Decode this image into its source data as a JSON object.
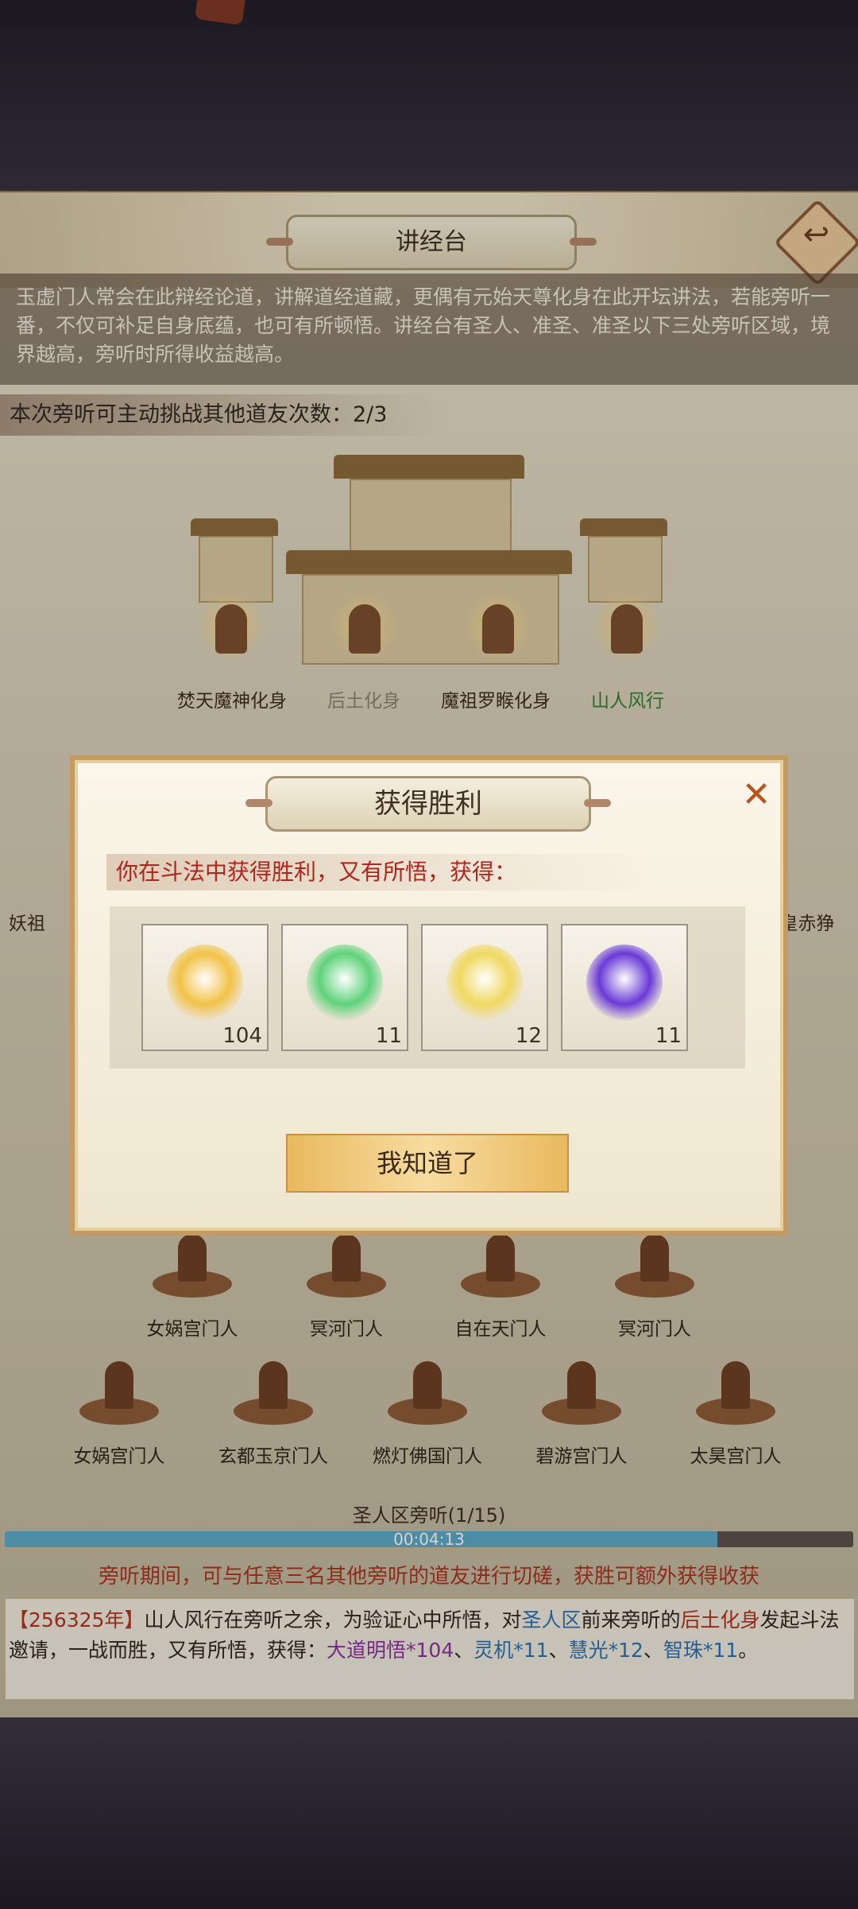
{
  "page": {
    "title": "讲经台",
    "intro": "玉虚门人常会在此辩经论道，讲解道经道藏，更偶有元始天尊化身在此开坛讲法，若能旁听一番，不仅可补足自身底蕴，也可有所顿悟。讲经台有圣人、准圣、准圣以下三处旁听区域，境界越高，旁听时所得收益越高。",
    "challenge_label": "本次旁听可主动挑战其他道友次数：",
    "challenge_count": "2/3"
  },
  "lecturers": [
    {
      "name": "焚天魔神化身"
    },
    {
      "name": "后土化身"
    },
    {
      "name": "魔祖罗睺化身"
    },
    {
      "name": "山人风行"
    }
  ],
  "side_labels": {
    "left": "妖祖",
    "right": "皇赤狰"
  },
  "listeners_row1": [
    {
      "name": "女娲宫门人"
    },
    {
      "name": "冥河门人"
    },
    {
      "name": "自在天门人"
    },
    {
      "name": "冥河门人"
    }
  ],
  "listeners_row2": [
    {
      "name": "女娲宫门人"
    },
    {
      "name": "玄都玉京门人"
    },
    {
      "name": "燃灯佛国门人"
    },
    {
      "name": "碧游宫门人"
    },
    {
      "name": "太昊宫门人"
    }
  ],
  "zone": {
    "label": "圣人区旁听(1/15)",
    "timer": "00:04:13",
    "progress": 0.84
  },
  "notice": "旁听期间，可与任意三名其他旁听的道友进行切磋，获胜可额外获得收获",
  "log": {
    "year": "【256325年】",
    "part1": "山人风行在旁听之余，为验证心中所悟，对",
    "zone": "圣人区",
    "part2": "前来旁听的",
    "target": "后土化身",
    "part3": "发起斗法邀请，一战而胜，又有所悟，获得：",
    "item1": "大道明悟*104",
    "sep1": "、",
    "item2": "灵机*11",
    "sep2": "、",
    "item3": "慧光*12",
    "sep3": "、",
    "item4": "智珠*11",
    "end": "。"
  },
  "dialog": {
    "title": "获得胜利",
    "message": "你在斗法中获得胜利，又有所悟，获得：",
    "rewards": [
      {
        "icon": "golden-flame-icon",
        "count": "104",
        "color": "#f2c247"
      },
      {
        "icon": "green-spirit-icon",
        "count": "11",
        "color": "#5fd27a"
      },
      {
        "icon": "golden-light-icon",
        "count": "12",
        "color": "#f0d860"
      },
      {
        "icon": "purple-pearl-icon",
        "count": "11",
        "color": "#6a3ad6"
      }
    ],
    "confirm_label": "我知道了",
    "close_symbol": "✕"
  }
}
